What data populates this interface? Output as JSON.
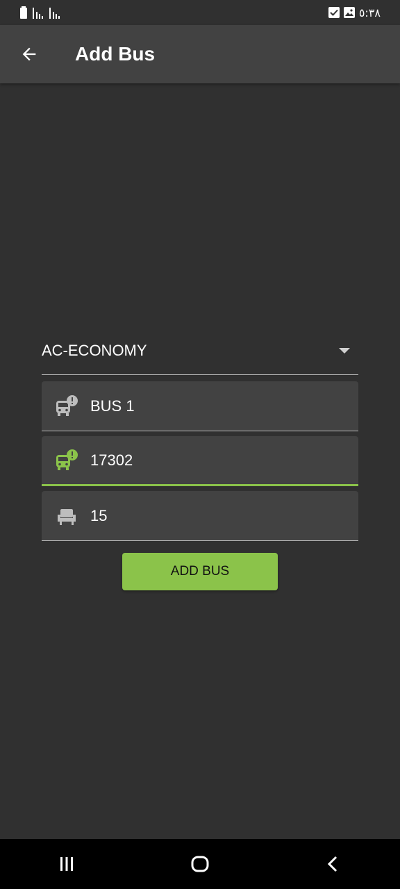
{
  "status_bar": {
    "time": "٥:٣٨",
    "left_icons": [
      "battery-icon",
      "signal-icon",
      "signal-icon"
    ],
    "right_icons": [
      "checkbox-icon",
      "image-icon"
    ]
  },
  "app_bar": {
    "title": "Add Bus",
    "back_icon": "arrow-left-icon"
  },
  "form": {
    "bus_type": {
      "value": "AC-ECONOMY",
      "icon": "dropdown-arrow-icon"
    },
    "fields": [
      {
        "value": "BUS 1",
        "icon": "bus-alert-icon",
        "icon_color": "#bdbdbd",
        "focused": false
      },
      {
        "value": "17302",
        "icon": "bus-alert-icon",
        "icon_color": "#8bc34a",
        "focused": true
      },
      {
        "value": "15",
        "icon": "seat-icon",
        "icon_color": "#bdbdbd",
        "focused": false
      }
    ],
    "submit_label": "ADD BUS"
  },
  "nav_bar": {
    "icons": [
      "recent-apps-icon",
      "home-icon",
      "back-icon"
    ]
  },
  "colors": {
    "background": "#303030",
    "app_bar": "#424242",
    "accent": "#8bc34a",
    "field_bg": "#424242"
  }
}
